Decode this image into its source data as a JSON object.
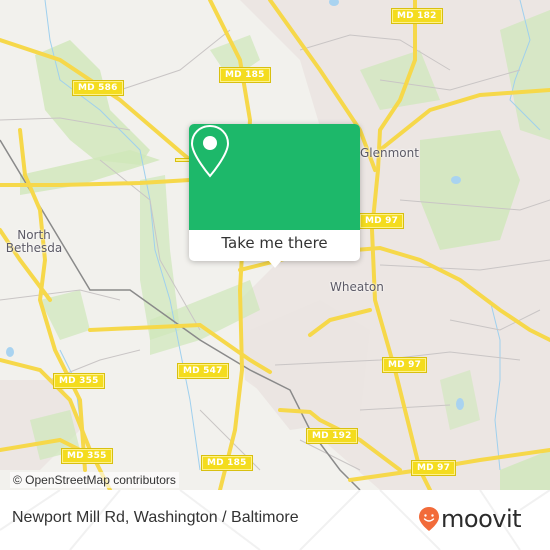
{
  "map": {
    "places": [
      {
        "name": "Glenmont"
      },
      {
        "name": "North\nBethesda"
      },
      {
        "name": "Wheaton"
      }
    ],
    "road_shields": [
      "MD 182",
      "MD 185",
      "MD 586",
      "MD 97",
      "MD 97",
      "MD 97",
      "MD 547",
      "MD 355",
      "MD 355",
      "MD 192",
      "MD 185"
    ],
    "attribution": "© OpenStreetMap contributors"
  },
  "popup": {
    "icon": "map-pin-icon",
    "cta_label": "Take me there",
    "accent_color": "#1db86a"
  },
  "footer": {
    "title": "Newport Mill Rd, Washington / Baltimore",
    "brand": "moovit",
    "brand_color": "#f26b3a"
  }
}
